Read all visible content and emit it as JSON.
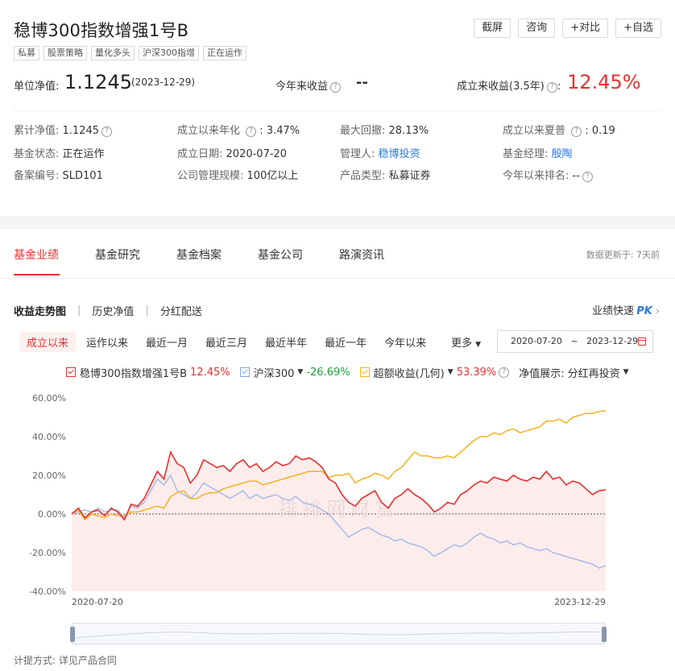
{
  "fund": {
    "name": "稳博300指数增强1号B",
    "tags": [
      "私募",
      "股票策略",
      "量化多头",
      "沪深300指增",
      "正在运作"
    ],
    "buttons": [
      "截屏",
      "咨询",
      "+对比",
      "+自选"
    ]
  },
  "nav": {
    "label": "单位净值:",
    "value": "1.1245",
    "date": "(2023-12-29)",
    "ytd_label": "今年来收益",
    "ytd_value": "--",
    "since_label": "成立来收益(3.5年)",
    "since_value": "12.45%"
  },
  "info": {
    "cum_nav_k": "累计净值:",
    "cum_nav_v": "1.1245",
    "annual_k": "成立以来年化",
    "annual_v": "3.47%",
    "mdd_k": "最大回撤:",
    "mdd_v": "28.13%",
    "sharpe_k": "成立以来夏普",
    "sharpe_v": "0.19",
    "status_k": "基金状态:",
    "status_v": "正在运作",
    "founded_k": "成立日期:",
    "founded_v": "2020-07-20",
    "manager_co_k": "管理人:",
    "manager_co_v": "稳博投资",
    "manager_k": "基金经理:",
    "manager_v": "殷陶",
    "record_k": "备案编号:",
    "record_v": "SLD101",
    "scale_k": "公司管理规模:",
    "scale_v": "100亿以上",
    "ptype_k": "产品类型:",
    "ptype_v": "私募证券",
    "rank_k": "今年以来排名:",
    "rank_v": "--"
  },
  "tabs": [
    "基金业绩",
    "基金研究",
    "基金档案",
    "基金公司",
    "路演资讯"
  ],
  "update_info": "数据更新于: 7天前",
  "subnav": [
    "收益走势图",
    "历史净值",
    "分红配送"
  ],
  "pk": {
    "label": "业绩快速",
    "pk": "PK"
  },
  "ranges": [
    "成立以来",
    "运作以来",
    "最近一月",
    "最近三月",
    "最近半年",
    "最近一年",
    "今年以来"
  ],
  "more_label": "更多",
  "date_range": {
    "start": "2020-07-20",
    "sep": "~",
    "end": "2023-12-29"
  },
  "legend": {
    "fund_name": "稳博300指数增强1号B",
    "fund_val": "12.45%",
    "index_name": "沪深300",
    "index_val": "-26.69%",
    "excess_name": "超额收益(几何)",
    "excess_val": "53.39%",
    "nav_show_label": "净值展示:",
    "nav_show_value": "分红再投资"
  },
  "colors": {
    "fund": "#e8302f",
    "index": "#a4bde6",
    "excess": "#f5b21e",
    "up": "#e8302f",
    "down": "#1aa23a"
  },
  "chart_data": {
    "type": "line",
    "yticks": [
      "60.00%",
      "40.00%",
      "20.00%",
      "0.00%",
      "-20.00%",
      "-40.00%"
    ],
    "ylim": [
      -40,
      60
    ],
    "x_labels": [
      "2020-07-20",
      "2023-12-29"
    ],
    "series": [
      {
        "name": "稳博300指数增强1号B",
        "values": [
          0,
          3,
          -2,
          1,
          2,
          -1,
          3,
          1,
          -3,
          5,
          4,
          8,
          15,
          22,
          18,
          32,
          26,
          24,
          16,
          20,
          28,
          26,
          24,
          25,
          22,
          26,
          28,
          24,
          26,
          22,
          24,
          27,
          25,
          26,
          30,
          28,
          29,
          27,
          24,
          18,
          16,
          10,
          6,
          4,
          8,
          10,
          12,
          6,
          3,
          8,
          10,
          13,
          10,
          8,
          5,
          1,
          3,
          6,
          5,
          10,
          12,
          15,
          17,
          16,
          19,
          18,
          17,
          20,
          18,
          17,
          19,
          18,
          22,
          18,
          19,
          15,
          17,
          16,
          13,
          10,
          12,
          12.45
        ]
      },
      {
        "name": "沪深300",
        "values": [
          0,
          1,
          2,
          1,
          3,
          1,
          2,
          2,
          -2,
          4,
          3,
          6,
          12,
          18,
          15,
          20,
          12,
          10,
          8,
          11,
          16,
          14,
          12,
          10,
          8,
          10,
          12,
          8,
          10,
          8,
          9,
          10,
          8,
          7,
          9,
          6,
          5,
          4,
          2,
          0,
          -4,
          -8,
          -12,
          -10,
          -8,
          -7,
          -9,
          -11,
          -12,
          -14,
          -13,
          -15,
          -16,
          -17,
          -19,
          -22,
          -20,
          -18,
          -16,
          -17,
          -15,
          -12,
          -10,
          -12,
          -13,
          -15,
          -14,
          -16,
          -15,
          -17,
          -18,
          -19,
          -18,
          -20,
          -21,
          -22,
          -23,
          -24,
          -25,
          -26,
          -28,
          -26.69
        ]
      },
      {
        "name": "超额收益(几何)",
        "values": [
          0,
          2,
          -3,
          0,
          -1,
          -2,
          0,
          -1,
          -1,
          1,
          1,
          2,
          3,
          4,
          3,
          9,
          11,
          12,
          8,
          8,
          10,
          11,
          11,
          13,
          14,
          15,
          16,
          17,
          17,
          15,
          16,
          17,
          18,
          19,
          20,
          21,
          22,
          22,
          22,
          19,
          20,
          20,
          21,
          16,
          18,
          19,
          21,
          20,
          18,
          22,
          24,
          28,
          32,
          30,
          30,
          29,
          29,
          30,
          29,
          32,
          35,
          38,
          40,
          40,
          42,
          41,
          43,
          44,
          42,
          43,
          44,
          45,
          48,
          48,
          49,
          47,
          50,
          51,
          52,
          52,
          53,
          53.39
        ]
      }
    ]
  },
  "watermark": "排排网财富",
  "footer_note": "计提方式: 详见产品合同"
}
